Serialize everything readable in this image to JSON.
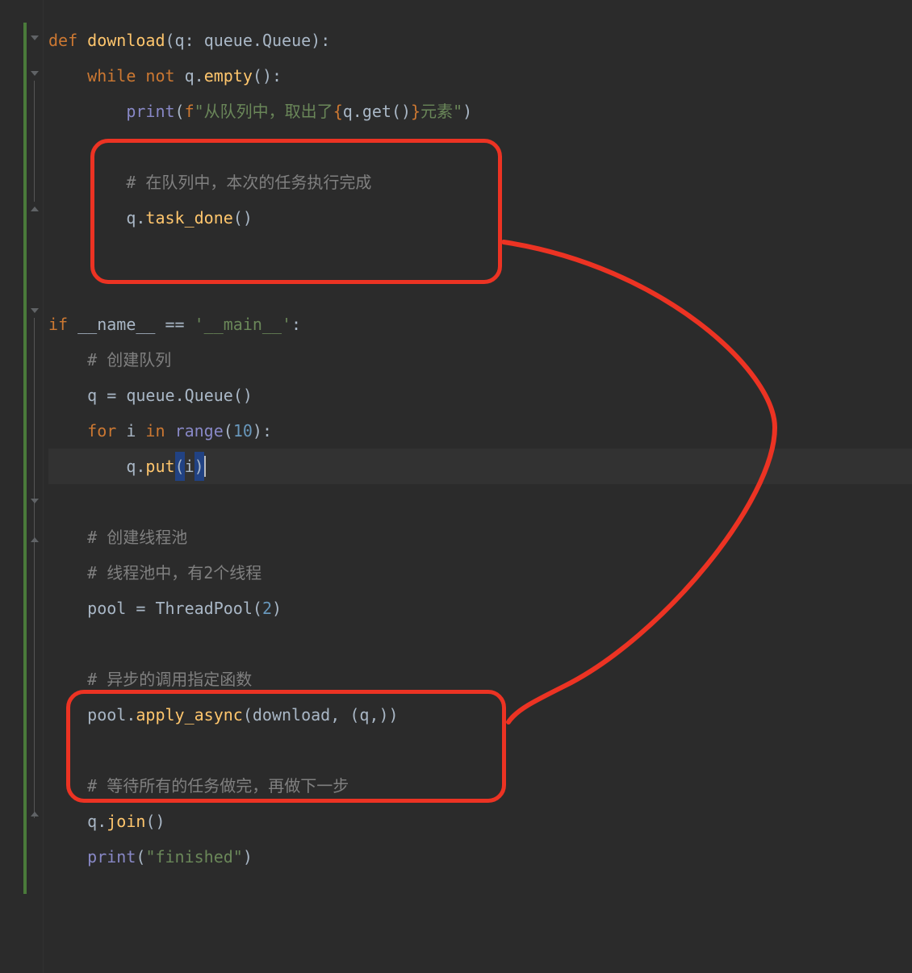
{
  "code": {
    "l1": {
      "def": "def ",
      "name": "download",
      "args_open": "(",
      "arg": "q",
      "colon": ": ",
      "type_mod": "queue",
      "dot": ".",
      "type_cls": "Queue",
      "args_close": ")",
      "end": ":"
    },
    "l2": {
      "indent": "    ",
      "while": "while ",
      "not": "not ",
      "obj": "q",
      "dot": ".",
      "method": "empty",
      "call": "()",
      "end": ":"
    },
    "l3": {
      "indent": "        ",
      "print": "print",
      "open": "(",
      "f": "f",
      "s1": "\"从队列中，取出了",
      "lb": "{",
      "expr": "q.get()",
      "rb": "}",
      "s2": "元素\"",
      "close": ")"
    },
    "l4": {
      "indent": "        ",
      "comment": "# 在队列中，本次的任务执行完成"
    },
    "l5": {
      "indent": "        ",
      "obj": "q",
      "dot": ".",
      "method": "task_done",
      "call": "()"
    },
    "l6": {
      "if": "if ",
      "name": "__name__",
      "eq": " == ",
      "str": "'__main__'",
      "end": ":"
    },
    "l7": {
      "indent": "    ",
      "comment": "# 创建队列"
    },
    "l8": {
      "indent": "    ",
      "var": "q",
      "eq": " = ",
      "mod": "queue",
      "dot": ".",
      "cls": "Queue",
      "call": "()"
    },
    "l9": {
      "indent": "    ",
      "for": "for ",
      "var": "i",
      "in": " in ",
      "range": "range",
      "open": "(",
      "num": "10",
      "close": ")",
      "end": ":"
    },
    "l10": {
      "indent": "        ",
      "obj": "q",
      "dot": ".",
      "method": "put",
      "open": "(",
      "arg": "i",
      "close": ")"
    },
    "l11": {
      "indent": "    ",
      "comment": "# 创建线程池"
    },
    "l12": {
      "indent": "    ",
      "comment": "# 线程池中，有2个线程"
    },
    "l13": {
      "indent": "    ",
      "var": "pool",
      "eq": " = ",
      "cls": "ThreadPool",
      "open": "(",
      "num": "2",
      "close": ")"
    },
    "l14": {
      "indent": "    ",
      "comment": "# 异步的调用指定函数"
    },
    "l15": {
      "indent": "    ",
      "obj": "pool",
      "dot": ".",
      "method": "apply_async",
      "open": "(",
      "a1": "download",
      "comma": ", ",
      "topen": "(",
      "a2": "q",
      "comma2": ",",
      "tclose": ")",
      "close": ")"
    },
    "l16": {
      "indent": "    ",
      "comment": "# 等待所有的任务做完，再做下一步"
    },
    "l17": {
      "indent": "    ",
      "obj": "q",
      "dot": ".",
      "method": "join",
      "call": "()"
    },
    "l18": {
      "indent": "    ",
      "print": "print",
      "open": "(",
      "str": "\"finished\"",
      "close": ")"
    }
  }
}
